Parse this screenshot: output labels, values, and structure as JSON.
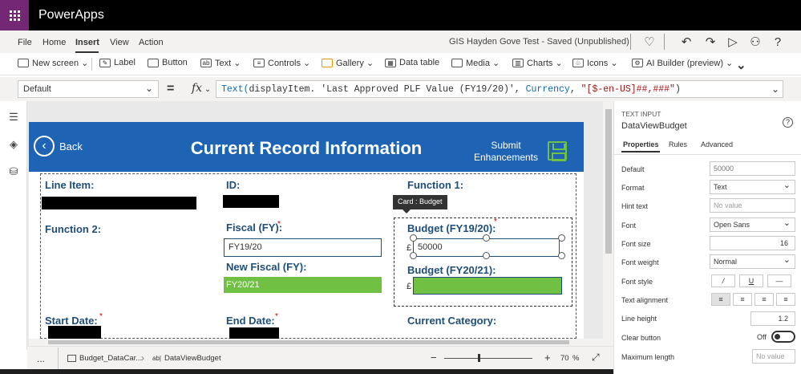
{
  "app": {
    "name": "PowerApps"
  },
  "menu": {
    "items": [
      "File",
      "Home",
      "Insert",
      "View",
      "Action"
    ],
    "active": "Insert"
  },
  "document": {
    "title": "GIS Hayden Gove Test - Saved (Unpublished)"
  },
  "ribbon": {
    "new_screen": "New screen ⌄",
    "label": "Label",
    "button": "Button",
    "text": "Text ⌄",
    "controls": "Controls ⌄",
    "gallery": "Gallery ⌄",
    "data_table": "Data table",
    "media": "Media ⌄",
    "charts": "Charts ⌄",
    "icons": "Icons ⌄",
    "ai_builder": "AI Builder (preview) ⌄"
  },
  "formula_bar": {
    "property": "Default",
    "equals": "=",
    "fx": "fx",
    "fn": "Text(",
    "arg1": "displayItem.",
    "arg2": "'Last Approved PLF Value (FY19/20)'",
    "comma1": ", ",
    "arg3": "Currency",
    "comma2": ", ",
    "arg4": "\"[$-en-US]##,###\"",
    "close": ")"
  },
  "screen": {
    "back_label": "Back",
    "title": "Current Record Information",
    "submit_line1": "Submit",
    "submit_line2": "Enhancements",
    "accent": "#1f64b4",
    "green": "#70c043"
  },
  "form": {
    "line_item_label": "Line Item:",
    "id_label": "ID:",
    "function1_label": "Function 1:",
    "function2_label": "Function 2:",
    "fiscal_label": "Fiscal (FY):",
    "fiscal_value": "FY19/20",
    "new_fiscal_label": "New Fiscal (FY):",
    "new_fiscal_value": "FY20/21",
    "budget1920_label": "Budget (FY19/20):",
    "budget1920_value": "50000",
    "budget2021_label": "Budget (FY20/21):",
    "start_date_label": "Start Date:",
    "end_date_label": "End Date:",
    "current_category_label": "Current Category:",
    "pound": "£",
    "required": "*"
  },
  "card_tag": "Card : Budget",
  "status": {
    "breadcrumb1": "Budget_DataCar...",
    "breadcrumb2": "DataViewBudget",
    "zoom": "70",
    "zoom_unit": "%",
    "minus": "−",
    "plus": "+",
    "more": "..."
  },
  "properties_panel": {
    "type": "TEXT INPUT",
    "control_name": "DataViewBudget",
    "tabs": [
      "Properties",
      "Rules",
      "Advanced"
    ],
    "default_label": "Default",
    "default_value": "50000",
    "format_label": "Format",
    "format_value": "Text",
    "hint_label": "Hint text",
    "hint_placeholder": "No value",
    "font_label": "Font",
    "font_value": "Open Sans",
    "font_size_label": "Font size",
    "font_size_value": "16",
    "font_weight_label": "Font weight",
    "font_weight_value": "Normal",
    "font_style_label": "Font style",
    "italic": "/",
    "underline": "U",
    "strike": "—",
    "align_label": "Text alignment",
    "line_height_label": "Line height",
    "line_height_value": "1.2",
    "clear_button_label": "Clear button",
    "clear_button_state": "Off",
    "max_length_label": "Maximum length",
    "max_length_placeholder": "No value"
  }
}
